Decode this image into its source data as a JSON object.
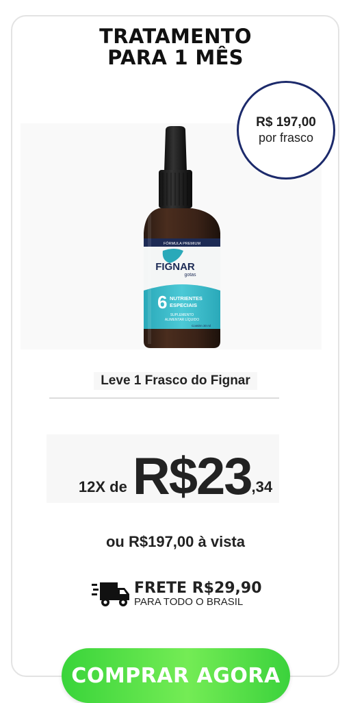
{
  "offer": {
    "title_line1": "TRATAMENTO",
    "title_line2": "PARA 1 MÊS",
    "bubble_price": "R$ 197,00",
    "bubble_unit": "por frasco",
    "caption": "Leve 1 Frasco do Fignar",
    "installments": {
      "prefix": "12X de",
      "main": "R$23",
      "cents": ",34"
    },
    "cash_price": "ou R$197,00 à vista",
    "shipping": {
      "title": "FRETE R$29,90",
      "subtitle": "PARA TODO O BRASIL",
      "icon": "truck-icon"
    },
    "buy_button": "COMPRAR AGORA"
  },
  "product_label": {
    "top_band": "FÓRMULA PREMIUM",
    "brand": "FIGNAR",
    "sub": "gotas",
    "number": "6",
    "nutrients": "NUTRIENTES",
    "special": "ESPECIAIS",
    "supplement_line1": "SUPLEMENTO",
    "supplement_line2": "ALIMENTAR LÍQUIDO",
    "volume": "Contém 30 ml"
  },
  "colors": {
    "bubble_border": "#1c2a6b",
    "button_green": "#4fdc43",
    "label_teal": "#34b9c8"
  }
}
